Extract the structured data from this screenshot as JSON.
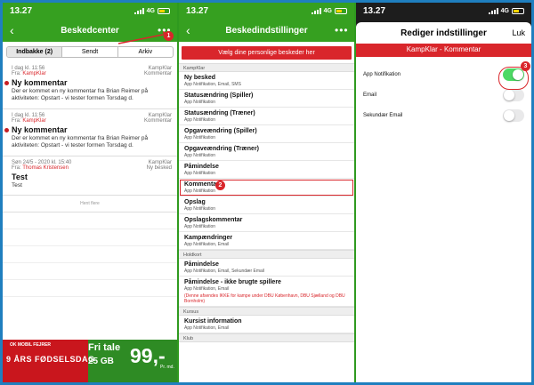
{
  "panel1": {
    "status": {
      "time": "13.27",
      "network": "4G"
    },
    "nav": {
      "title": "Beskedcenter"
    },
    "tabs": [
      {
        "label": "Indbakke (2)",
        "active": true
      },
      {
        "label": "Sendt",
        "active": false
      },
      {
        "label": "Arkiv",
        "active": false
      }
    ],
    "messages": [
      {
        "time": "I dag kl. 11:56",
        "source": "KampKlar",
        "from_prefix": "Fra:",
        "from": "KampKlar",
        "type": "Kommentar",
        "subject": "Ny kommentar",
        "body": "Der er kommet en ny kommentar fra Brian Reimer på aktiviteten: Opstart - vi tester formen Torsdag d.",
        "unread": true
      },
      {
        "time": "I dag kl. 11:56",
        "source": "KampKlar",
        "from_prefix": "Fra:",
        "from": "KampKlar",
        "type": "Kommentar",
        "subject": "Ny kommentar",
        "body": "Der er kommet en ny kommentar fra Brian Reimer på aktiviteten: Opstart - vi tester formen Torsdag d.",
        "unread": true
      },
      {
        "time": "Søn 24/5 - 2020 kl. 15:40",
        "source": "KampKlar",
        "from_prefix": "Fra:",
        "from": "Thomas Kristensen",
        "type": "Ny besked",
        "subject": "Test",
        "body": "Test",
        "unread": false
      }
    ],
    "load_more": "Hent flere",
    "badge": "1",
    "ad": {
      "top": "OK MOBIL FEJRER",
      "birthday": "9 ÅRS FØDSELSDAG",
      "free": "Fri tale",
      "gb": "25 GB",
      "price": "99,-",
      "per_month": "Pr. md."
    }
  },
  "panel2": {
    "status": {
      "time": "13.27",
      "network": "4G"
    },
    "nav": {
      "title": "Beskedindstillinger"
    },
    "choose_button": "Vælg dine personlige beskeder her",
    "badge": "2",
    "sections": [
      {
        "header": "KampKlar",
        "items": [
          {
            "title": "Ny besked",
            "sub": "App Notifikation, Email, SMS"
          },
          {
            "title": "Statusændring (Spiller)",
            "sub": "App Notifikation"
          },
          {
            "title": "Statusændring (Træner)",
            "sub": "App Notifikation"
          },
          {
            "title": "Opgaveændring (Spiller)",
            "sub": "App Notifikation"
          },
          {
            "title": "Opgaveændring (Træner)",
            "sub": "App Notifikation"
          },
          {
            "title": "Påmindelse",
            "sub": "App Notifikation"
          },
          {
            "title": "Kommentar",
            "sub": "App Notifikation"
          },
          {
            "title": "Opslag",
            "sub": "App Notifikation"
          },
          {
            "title": "Opslagskommentar",
            "sub": "App Notifikation"
          },
          {
            "title": "Kampændringer",
            "sub": "App Notifikation, Email"
          }
        ]
      },
      {
        "header": "Holdkort",
        "items": [
          {
            "title": "Påmindelse",
            "sub": "App Notifikation, Email, Sekundær Email"
          },
          {
            "title": "Påmindelse - ikke brugte spillere",
            "sub": "App Notifikation, Email",
            "note": "(Denne afsendes IKKE for kampe under DBU København, DBU Sjælland og DBU Bornholm)"
          }
        ]
      },
      {
        "header": "Kursus",
        "items": [
          {
            "title": "Kursist information",
            "sub": "App Notifikation, Email"
          }
        ]
      },
      {
        "header": "Klub",
        "items": []
      }
    ]
  },
  "panel3": {
    "status": {
      "time": "13.27",
      "network": "4G"
    },
    "modal": {
      "title": "Rediger indstillinger",
      "close": "Luk"
    },
    "subtitle": "KampKlar - Kommentar",
    "badge": "3",
    "toggles": [
      {
        "label": "App Notifikation",
        "on": true
      },
      {
        "label": "Email",
        "on": false
      },
      {
        "label": "Sekundær Email",
        "on": false
      }
    ]
  },
  "colors": {
    "brand_green": "#36a020",
    "accent_red": "#d9262b",
    "toggle_on": "#4cd964",
    "frame_blue": "#1f7fbf"
  }
}
